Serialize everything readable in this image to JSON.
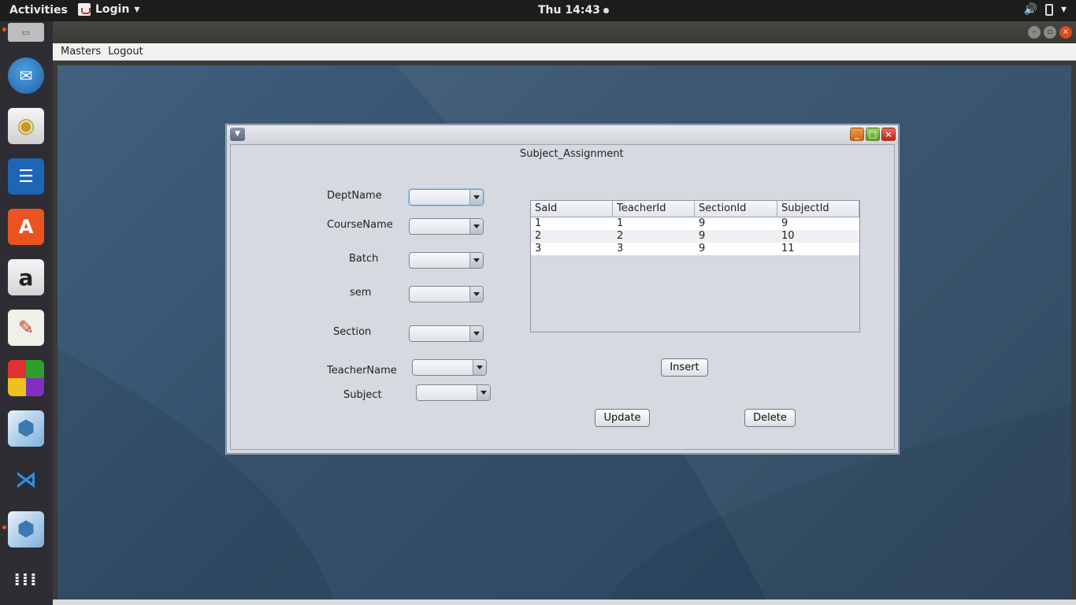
{
  "topbar": {
    "activities": "Activities",
    "app_menu": "Login",
    "clock": "Thu 14:43"
  },
  "dock": {
    "items": [
      "files",
      "thunderbird",
      "rhythmbox",
      "libreoffice-writer",
      "ubuntu-software",
      "amazon",
      "text-editor",
      "game",
      "netbeans",
      "vscode",
      "netbeans-running",
      "show-apps"
    ]
  },
  "menubar": {
    "items": [
      "Masters",
      "Logout"
    ]
  },
  "form": {
    "title": "Subject_Assignment",
    "labels": {
      "dept": "DeptName",
      "course": "CourseName",
      "batch": "Batch",
      "sem": "sem",
      "section": "Section",
      "teacher": "TeacherName",
      "subject": "Subject"
    },
    "buttons": {
      "insert": "Insert",
      "update": "Update",
      "delete": "Delete"
    },
    "table": {
      "columns": [
        "SaId",
        "TeacherId",
        "SectionId",
        "SubjectId"
      ],
      "rows": [
        [
          "1",
          "1",
          "9",
          "9"
        ],
        [
          "2",
          "2",
          "9",
          "10"
        ],
        [
          "3",
          "3",
          "9",
          "11"
        ]
      ]
    }
  }
}
